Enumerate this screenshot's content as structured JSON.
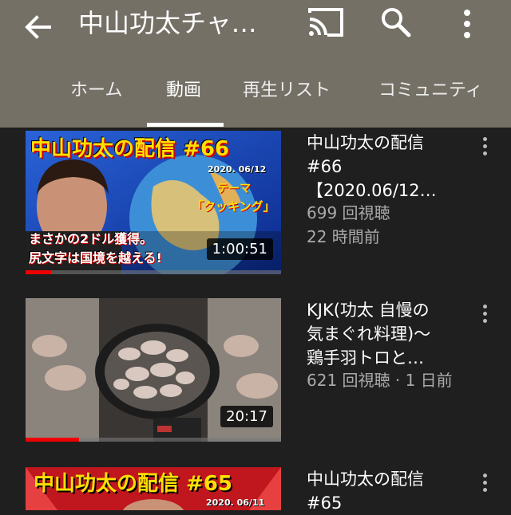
{
  "appbar": {
    "title": "中山功太チャ…",
    "icons": [
      "back-arrow-icon",
      "cast-icon",
      "search-icon",
      "more-vert-icon"
    ]
  },
  "tabs": [
    {
      "label": "ホーム",
      "active": false
    },
    {
      "label": "動画",
      "active": true
    },
    {
      "label": "再生リスト",
      "active": false
    },
    {
      "label": "コミュニティ",
      "active": false
    }
  ],
  "videos": [
    {
      "title": "中山功太の配信\n#66\n【2020.06/12…",
      "views": "699 回視聴",
      "age": "22 時間前",
      "duration": "1:00:51",
      "watched_fraction": 0.1,
      "thumb": {
        "headline": "中山功太の配信 #66",
        "date": "2020. 06/12",
        "theme": "テーマ",
        "theme_title": "「クッキング」",
        "caption1": "まさかの2ドル獲得。",
        "caption2": "尻文字は国境を越える!"
      }
    },
    {
      "title": "KJK(功太 自慢の\n気まぐれ料理)〜\n鶏手羽トロと…",
      "views_age": "621 回視聴 · 1 日前",
      "duration": "20:17",
      "watched_fraction": 0.21
    },
    {
      "title": "中山功太の配信\n#65",
      "thumb": {
        "headline": "中山功太の配信 #65",
        "date": "2020. 06/11"
      }
    }
  ],
  "colors": {
    "appbar": "#757066",
    "background": "#1f1f1f",
    "progress": "#e00000",
    "thumb_headline": "#ffe000"
  }
}
